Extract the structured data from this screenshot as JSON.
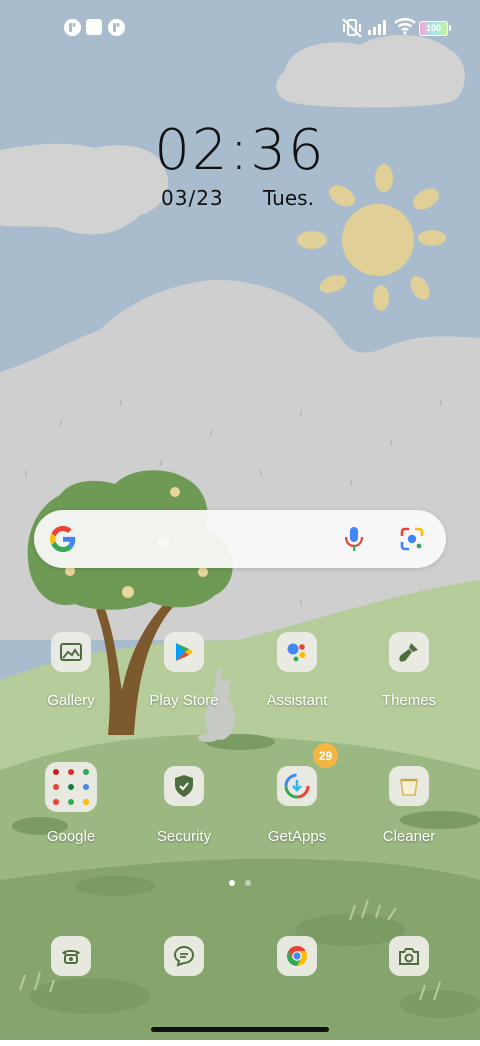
{
  "status_bar": {
    "battery": "100",
    "icons": [
      "notification-app-icon",
      "notification-square-icon",
      "notification-app-icon",
      "vibrate-off-icon",
      "signal-icon",
      "wifi-icon",
      "battery-icon"
    ]
  },
  "lockscreen_widget": {
    "time": "02:36",
    "date": "03/23",
    "day": "Tues."
  },
  "search_bar": {
    "icons": [
      "google-g-icon",
      "microphone-icon",
      "google-lens-icon"
    ]
  },
  "home_apps": [
    {
      "label": "Gallery",
      "icon": "gallery-icon"
    },
    {
      "label": "Play Store",
      "icon": "play-store-icon"
    },
    {
      "label": "Assistant",
      "icon": "assistant-icon"
    },
    {
      "label": "Themes",
      "icon": "themes-brush-icon"
    },
    {
      "label": "Google",
      "icon": "google-folder-icon"
    },
    {
      "label": "Security",
      "icon": "security-shield-icon"
    },
    {
      "label": "GetApps",
      "icon": "getapps-icon",
      "badge": "29"
    },
    {
      "label": "Cleaner",
      "icon": "cleaner-icon"
    }
  ],
  "page_indicator": {
    "pages": 2,
    "current": 1
  },
  "dock": [
    {
      "icon": "phone-icon"
    },
    {
      "icon": "messages-icon"
    },
    {
      "icon": "chrome-icon"
    },
    {
      "icon": "camera-icon"
    }
  ],
  "colors": {
    "sky": "#a9bccd",
    "cloud": "#cfcfcf",
    "sun": "#e0cf97",
    "hill_light": "#b6cc9a",
    "hill_mid": "#97b37d",
    "hill_dark": "#7a9b62",
    "badge": "#f4b640"
  }
}
